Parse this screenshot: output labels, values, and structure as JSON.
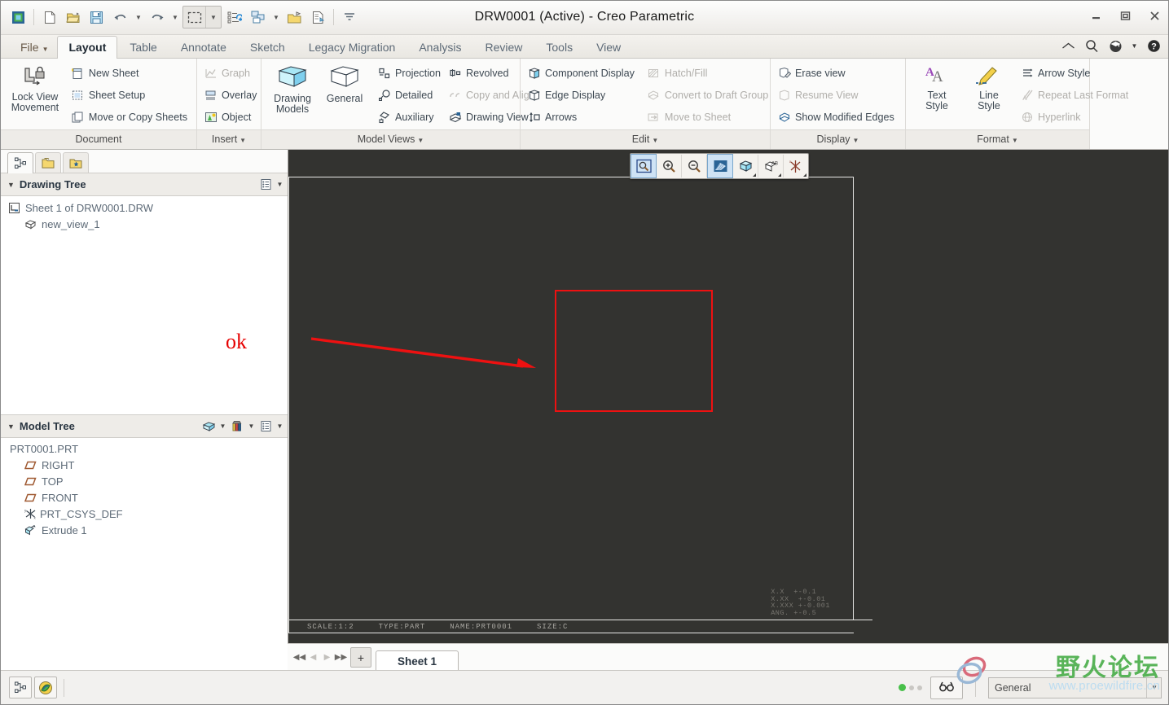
{
  "window": {
    "title": "DRW0001 (Active) - Creo Parametric",
    "minimize": "–",
    "maximize": "□",
    "close": "✕"
  },
  "quick_access": {
    "items": [
      {
        "name": "creo-logo-icon",
        "label": ""
      },
      {
        "name": "new-file-icon",
        "label": ""
      },
      {
        "name": "open-folder-icon",
        "label": ""
      },
      {
        "name": "save-icon",
        "label": ""
      },
      {
        "name": "undo-icon",
        "label": ""
      },
      {
        "name": "redo-icon",
        "label": ""
      },
      {
        "name": "select-box-icon",
        "label": ""
      },
      {
        "name": "regenerate-icon",
        "label": ""
      },
      {
        "name": "window-switch-icon",
        "label": ""
      },
      {
        "name": "open-last-session-icon",
        "label": ""
      },
      {
        "name": "close-window-icon",
        "label": ""
      },
      {
        "name": "customize-qat-icon",
        "label": ""
      }
    ]
  },
  "header_icons": [
    {
      "name": "collapse-ribbon-icon",
      "glyph": "⌃"
    },
    {
      "name": "search-icon",
      "glyph": "⚲"
    },
    {
      "name": "learning-connector-icon",
      "glyph": "●"
    },
    {
      "name": "help-icon",
      "glyph": "?"
    }
  ],
  "ribbon_tabs": [
    {
      "label": "File",
      "name": "tab-file",
      "active": false,
      "is_file": true
    },
    {
      "label": "Layout",
      "name": "tab-layout",
      "active": true
    },
    {
      "label": "Table",
      "name": "tab-table",
      "active": false
    },
    {
      "label": "Annotate",
      "name": "tab-annotate",
      "active": false
    },
    {
      "label": "Sketch",
      "name": "tab-sketch",
      "active": false
    },
    {
      "label": "Legacy Migration",
      "name": "tab-legacy-migration",
      "active": false
    },
    {
      "label": "Analysis",
      "name": "tab-analysis",
      "active": false
    },
    {
      "label": "Review",
      "name": "tab-review",
      "active": false
    },
    {
      "label": "Tools",
      "name": "tab-tools",
      "active": false
    },
    {
      "label": "View",
      "name": "tab-view",
      "active": false
    }
  ],
  "ribbon": {
    "document": {
      "group_label": "Document",
      "has_dialog_launcher": false,
      "lock_view_movement": {
        "line1": "Lock View",
        "line2": "Movement"
      },
      "items": [
        {
          "label": "New Sheet",
          "name": "new-sheet-button",
          "disabled": false
        },
        {
          "label": "Sheet Setup",
          "name": "sheet-setup-button",
          "disabled": false
        },
        {
          "label": "Move or Copy Sheets",
          "name": "move-or-copy-sheets-button",
          "disabled": false
        }
      ]
    },
    "insert": {
      "group_label": "Insert",
      "has_dialog_launcher": true,
      "items": [
        {
          "label": "Graph",
          "name": "graph-button",
          "disabled": true
        },
        {
          "label": "Overlay",
          "name": "overlay-button",
          "disabled": false
        },
        {
          "label": "Object",
          "name": "object-button",
          "disabled": false
        }
      ]
    },
    "model_views": {
      "group_label": "Model Views",
      "has_dialog_launcher": true,
      "big_buttons": [
        {
          "line1": "Drawing",
          "line2": "Models",
          "name": "drawing-models-button"
        },
        {
          "line1": "General",
          "line2": "",
          "name": "general-view-button"
        }
      ],
      "col1": [
        {
          "label": "Projection",
          "name": "projection-view-button",
          "disabled": false
        },
        {
          "label": "Detailed",
          "name": "detailed-view-button",
          "disabled": false
        },
        {
          "label": "Auxiliary",
          "name": "auxiliary-view-button",
          "disabled": false
        }
      ],
      "col2": [
        {
          "label": "Revolved",
          "name": "revolved-view-button",
          "disabled": false
        },
        {
          "label": "Copy and Align",
          "name": "copy-and-align-button",
          "disabled": true
        },
        {
          "label": "Drawing View",
          "name": "drawing-view-button",
          "disabled": false
        }
      ]
    },
    "edit": {
      "group_label": "Edit",
      "has_dialog_launcher": true,
      "col1": [
        {
          "label": "Component Display",
          "name": "component-display-button",
          "disabled": false
        },
        {
          "label": "Edge Display",
          "name": "edge-display-button",
          "disabled": false
        },
        {
          "label": "Arrows",
          "name": "arrows-button",
          "disabled": false
        }
      ],
      "col2": [
        {
          "label": "Hatch/Fill",
          "name": "hatch-fill-button",
          "disabled": true
        },
        {
          "label": "Convert to Draft Group",
          "name": "convert-to-draft-group-button",
          "disabled": true
        },
        {
          "label": "Move to Sheet",
          "name": "move-to-sheet-button",
          "disabled": true
        }
      ]
    },
    "display": {
      "group_label": "Display",
      "has_dialog_launcher": true,
      "items": [
        {
          "label": "Erase view",
          "name": "erase-view-button",
          "disabled": false
        },
        {
          "label": "Resume View",
          "name": "resume-view-button",
          "disabled": true
        },
        {
          "label": "Show Modified Edges",
          "name": "show-modified-edges-button",
          "disabled": false
        }
      ]
    },
    "format": {
      "group_label": "Format",
      "has_dialog_launcher": true,
      "big_buttons": [
        {
          "line1": "Text",
          "line2": "Style",
          "name": "text-style-button"
        },
        {
          "line1": "Line",
          "line2": "Style",
          "name": "line-style-button"
        }
      ],
      "items": [
        {
          "label": "Arrow Style",
          "name": "arrow-style-button",
          "disabled": false
        },
        {
          "label": "Repeat Last Format",
          "name": "repeat-last-format-button",
          "disabled": true
        },
        {
          "label": "Hyperlink",
          "name": "hyperlink-button",
          "disabled": true
        }
      ]
    }
  },
  "left_panel": {
    "nav_tabs": [
      {
        "name": "nav-tab-model-tree",
        "active": true
      },
      {
        "name": "nav-tab-folder-browser",
        "active": false
      },
      {
        "name": "nav-tab-favorites",
        "active": false
      }
    ],
    "drawing_tree": {
      "title": "Drawing Tree",
      "nodes": [
        {
          "label": "Sheet 1 of DRW0001.DRW",
          "name": "tree-node-sheet",
          "icon": "sheet-icon",
          "indent": 0
        },
        {
          "label": "new_view_1",
          "name": "tree-node-new-view-1",
          "icon": "view-icon",
          "indent": 1
        }
      ]
    },
    "model_tree": {
      "title": "Model Tree",
      "nodes": [
        {
          "label": "PRT0001.PRT",
          "name": "tree-node-part",
          "icon": "none",
          "indent": 0
        },
        {
          "label": "RIGHT",
          "name": "tree-node-right-plane",
          "icon": "datum-plane-icon",
          "indent": 1
        },
        {
          "label": "TOP",
          "name": "tree-node-top-plane",
          "icon": "datum-plane-icon",
          "indent": 1
        },
        {
          "label": "FRONT",
          "name": "tree-node-front-plane",
          "icon": "datum-plane-icon",
          "indent": 1
        },
        {
          "label": "PRT_CSYS_DEF",
          "name": "tree-node-csys",
          "icon": "csys-icon",
          "indent": 1
        },
        {
          "label": "Extrude 1",
          "name": "tree-node-extrude-1",
          "icon": "extrude-icon",
          "indent": 1
        }
      ]
    }
  },
  "graphics_toolbar": [
    {
      "name": "refit-icon",
      "active": false
    },
    {
      "name": "zoom-in-icon",
      "active": false
    },
    {
      "name": "zoom-out-icon",
      "active": false
    },
    {
      "name": "repaint-icon",
      "active": true
    },
    {
      "name": "display-style-icon",
      "active": false
    },
    {
      "name": "annotation-display-icon",
      "active": false
    },
    {
      "name": "datum-display-icon",
      "active": false
    }
  ],
  "sheet": {
    "status_fields": [
      {
        "label": "SCALE:1:2",
        "name": "sheet-scale"
      },
      {
        "label": "TYPE:PART",
        "name": "sheet-type"
      },
      {
        "label": "NAME:PRT0001",
        "name": "sheet-name"
      },
      {
        "label": "SIZE:C",
        "name": "sheet-size"
      }
    ],
    "tolerance_block": "X.X  +-0.1\nX.XX  +-0.01\nX.XXX +-0.001\nANG. +-0.5",
    "annotations": {
      "ok_text": "ok"
    }
  },
  "sheet_tabs": {
    "first_label": "◀◀",
    "prev_label": "◀",
    "next_label": "▶",
    "last_label": "▶▶",
    "add_label": "+",
    "tabs": [
      {
        "label": "Sheet 1",
        "name": "sheet-tab-1",
        "active": true
      }
    ]
  },
  "status_bar": {
    "left_buttons": [
      {
        "name": "model-tree-toggle-icon"
      },
      {
        "name": "browser-toggle-icon"
      }
    ],
    "selection_filter": {
      "value": "General",
      "name": "selection-filter-select"
    },
    "search_button": {
      "name": "find-icon"
    }
  },
  "watermark": {
    "forum_name": "野火论坛",
    "url": "www.proewildfire.cn"
  },
  "colors": {
    "accent_blue": "#2a6496",
    "annotation_red": "#ee1111",
    "canvas": "#333330",
    "watermark_green": "#4cae4c",
    "status_ok_green": "#48c04a"
  }
}
